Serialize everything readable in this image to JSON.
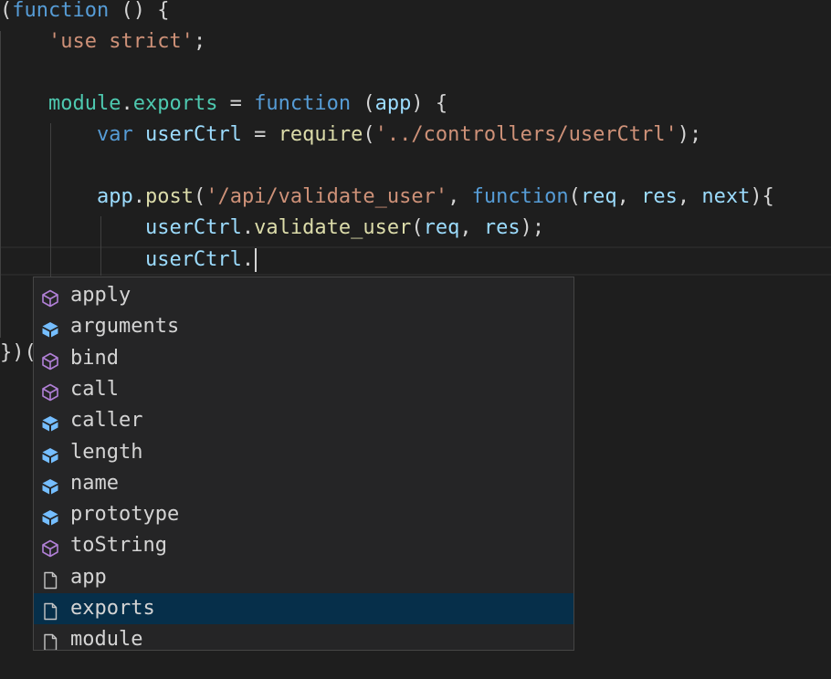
{
  "code": {
    "lines": [
      [
        {
          "t": "(",
          "c": ""
        },
        {
          "t": "function",
          "c": "kw"
        },
        {
          "t": " () {",
          "c": ""
        }
      ],
      [
        {
          "t": "    ",
          "c": ""
        },
        {
          "t": "'use strict'",
          "c": "str"
        },
        {
          "t": ";",
          "c": ""
        }
      ],
      [],
      [
        {
          "t": "    ",
          "c": ""
        },
        {
          "t": "module",
          "c": "mod"
        },
        {
          "t": ".",
          "c": ""
        },
        {
          "t": "exports",
          "c": "mod"
        },
        {
          "t": " = ",
          "c": ""
        },
        {
          "t": "function",
          "c": "kw"
        },
        {
          "t": " (",
          "c": ""
        },
        {
          "t": "app",
          "c": "id"
        },
        {
          "t": ") {",
          "c": ""
        }
      ],
      [
        {
          "t": "        ",
          "c": ""
        },
        {
          "t": "var",
          "c": "kw"
        },
        {
          "t": " ",
          "c": ""
        },
        {
          "t": "userCtrl",
          "c": "id"
        },
        {
          "t": " = ",
          "c": ""
        },
        {
          "t": "require",
          "c": "fn"
        },
        {
          "t": "(",
          "c": ""
        },
        {
          "t": "'../controllers/userCtrl'",
          "c": "str"
        },
        {
          "t": ");",
          "c": ""
        }
      ],
      [],
      [
        {
          "t": "        ",
          "c": ""
        },
        {
          "t": "app",
          "c": "id"
        },
        {
          "t": ".",
          "c": ""
        },
        {
          "t": "post",
          "c": "fn"
        },
        {
          "t": "(",
          "c": ""
        },
        {
          "t": "'/api/validate_user'",
          "c": "str"
        },
        {
          "t": ", ",
          "c": ""
        },
        {
          "t": "function",
          "c": "kw"
        },
        {
          "t": "(",
          "c": ""
        },
        {
          "t": "req",
          "c": "id"
        },
        {
          "t": ", ",
          "c": ""
        },
        {
          "t": "res",
          "c": "id"
        },
        {
          "t": ", ",
          "c": ""
        },
        {
          "t": "next",
          "c": "id"
        },
        {
          "t": "){",
          "c": ""
        }
      ],
      [
        {
          "t": "            ",
          "c": ""
        },
        {
          "t": "userCtrl",
          "c": "id"
        },
        {
          "t": ".",
          "c": ""
        },
        {
          "t": "validate_user",
          "c": "fn"
        },
        {
          "t": "(",
          "c": ""
        },
        {
          "t": "req",
          "c": "id"
        },
        {
          "t": ", ",
          "c": ""
        },
        {
          "t": "res",
          "c": "id"
        },
        {
          "t": ");",
          "c": ""
        }
      ],
      [
        {
          "t": "            ",
          "c": ""
        },
        {
          "t": "userCtrl",
          "c": "id"
        },
        {
          "t": ".",
          "c": ""
        }
      ],
      [],
      [],
      [
        {
          "t": "})(",
          "c": ""
        }
      ]
    ]
  },
  "suggest": {
    "items": [
      {
        "label": "apply",
        "icon": "method-icon"
      },
      {
        "label": "arguments",
        "icon": "field-icon"
      },
      {
        "label": "bind",
        "icon": "method-icon"
      },
      {
        "label": "call",
        "icon": "method-icon"
      },
      {
        "label": "caller",
        "icon": "field-icon"
      },
      {
        "label": "length",
        "icon": "field-icon"
      },
      {
        "label": "name",
        "icon": "field-icon"
      },
      {
        "label": "prototype",
        "icon": "field-icon"
      },
      {
        "label": "toString",
        "icon": "method-icon"
      },
      {
        "label": "app",
        "icon": "text-file-icon"
      },
      {
        "label": "exports",
        "icon": "text-file-icon",
        "selected": true
      },
      {
        "label": "module",
        "icon": "text-file-icon"
      }
    ]
  },
  "colors": {
    "keyword": "#569cd6",
    "string": "#ce9178",
    "identifier": "#9cdcfe",
    "function": "#dcdcaa",
    "module": "#4ec9b0",
    "method_icon": "#b180d7",
    "field_icon": "#75beff",
    "selection": "#062f4a"
  }
}
